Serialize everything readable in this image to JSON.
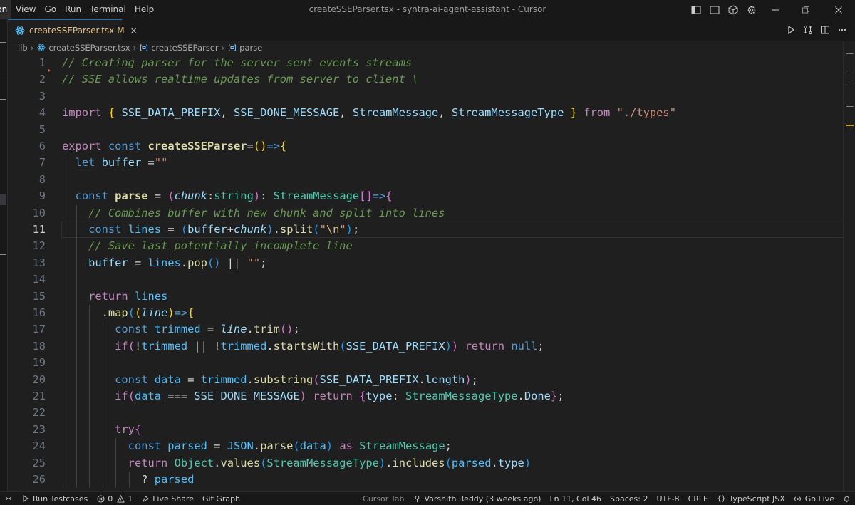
{
  "window": {
    "title": "createSSEParser.tsx - syntra-ai-agent-assistant - Cursor",
    "menu": [
      "ion",
      "View",
      "Go",
      "Run",
      "Terminal",
      "Help"
    ]
  },
  "tab": {
    "label": "createSSEParser.tsx",
    "modified": "M",
    "close": "×"
  },
  "breadcrumb": {
    "folder": "lib",
    "file": "createSSEParser.tsx",
    "symbol1": "createSSEParser",
    "symbol2": "parse"
  },
  "editor": {
    "active_line": 11,
    "lines": [
      {
        "n": "1",
        "tokens": [
          [
            "// Creating parser for the server sent events streams",
            "comment"
          ]
        ]
      },
      {
        "n": "2",
        "tokens": [
          [
            "// SSE allows realtime updates from server to client \\",
            "comment"
          ]
        ]
      },
      {
        "n": "3",
        "tokens": []
      },
      {
        "n": "4",
        "tokens": [
          [
            "import",
            "control"
          ],
          [
            " ",
            "punct"
          ],
          [
            "{",
            "b1"
          ],
          [
            " ",
            "punct"
          ],
          [
            "SSE_DATA_PREFIX",
            "var"
          ],
          [
            ", ",
            "punct"
          ],
          [
            "SSE_DONE_MESSAGE",
            "var"
          ],
          [
            ", ",
            "punct"
          ],
          [
            "StreamMessage",
            "var"
          ],
          [
            ", ",
            "punct"
          ],
          [
            "StreamMessageType",
            "var"
          ],
          [
            " ",
            "punct"
          ],
          [
            "}",
            "b1"
          ],
          [
            " ",
            "punct"
          ],
          [
            "from",
            "control"
          ],
          [
            " ",
            "punct"
          ],
          [
            "\"./types\"",
            "string"
          ]
        ]
      },
      {
        "n": "5",
        "tokens": []
      },
      {
        "n": "6",
        "tokens": [
          [
            "export",
            "control"
          ],
          [
            " ",
            "punct"
          ],
          [
            "const",
            "keyword"
          ],
          [
            " ",
            "punct"
          ],
          [
            "createSSEParser",
            "funcdecl"
          ],
          [
            "=",
            "punct"
          ],
          [
            "()",
            "b1"
          ],
          [
            "=>",
            "keyword"
          ],
          [
            "{",
            "b1"
          ]
        ]
      },
      {
        "n": "7",
        "tokens": [
          [
            "  ",
            "punct"
          ],
          [
            "let",
            "keyword"
          ],
          [
            " ",
            "punct"
          ],
          [
            "buffer",
            "var"
          ],
          [
            " =",
            "punct"
          ],
          [
            "\"\"",
            "string"
          ]
        ]
      },
      {
        "n": "8",
        "tokens": []
      },
      {
        "n": "9",
        "tokens": [
          [
            "  ",
            "punct"
          ],
          [
            "const",
            "keyword"
          ],
          [
            " ",
            "punct"
          ],
          [
            "parse",
            "funcdecl"
          ],
          [
            " = ",
            "punct"
          ],
          [
            "(",
            "b2"
          ],
          [
            "chunk",
            "param"
          ],
          [
            ":",
            "punct"
          ],
          [
            "string",
            "type"
          ],
          [
            ")",
            "b2"
          ],
          [
            ": ",
            "punct"
          ],
          [
            "StreamMessage",
            "type"
          ],
          [
            "[]",
            "b2"
          ],
          [
            "=>",
            "keyword"
          ],
          [
            "{",
            "b2"
          ]
        ]
      },
      {
        "n": "10",
        "tokens": [
          [
            "    ",
            "punct"
          ],
          [
            "// Combines buffer with new chunk and split into lines",
            "comment"
          ]
        ]
      },
      {
        "n": "11",
        "tokens": [
          [
            "    ",
            "punct"
          ],
          [
            "const",
            "keyword"
          ],
          [
            " ",
            "punct"
          ],
          [
            "lines",
            "const"
          ],
          [
            " = ",
            "punct"
          ],
          [
            "(",
            "b3"
          ],
          [
            "buffer",
            "var"
          ],
          [
            "+",
            "punct"
          ],
          [
            "chunk",
            "param"
          ],
          [
            ")",
            "b3"
          ],
          [
            ".",
            "punct"
          ],
          [
            "split",
            "func"
          ],
          [
            "(",
            "b3"
          ],
          [
            "\"",
            "string"
          ],
          [
            "\\n",
            "escape"
          ],
          [
            "\"",
            "string"
          ],
          [
            ")",
            "b3"
          ],
          [
            ";",
            "punct"
          ]
        ]
      },
      {
        "n": "12",
        "tokens": [
          [
            "    ",
            "punct"
          ],
          [
            "// Save last potentially incomplete line",
            "comment"
          ]
        ]
      },
      {
        "n": "13",
        "tokens": [
          [
            "    ",
            "punct"
          ],
          [
            "buffer",
            "var"
          ],
          [
            " = ",
            "punct"
          ],
          [
            "lines",
            "const"
          ],
          [
            ".",
            "punct"
          ],
          [
            "pop",
            "func"
          ],
          [
            "()",
            "b3"
          ],
          [
            " || ",
            "punct"
          ],
          [
            "\"\"",
            "string"
          ],
          [
            ";",
            "punct"
          ]
        ]
      },
      {
        "n": "14",
        "tokens": []
      },
      {
        "n": "15",
        "tokens": [
          [
            "    ",
            "punct"
          ],
          [
            "return",
            "control"
          ],
          [
            " ",
            "punct"
          ],
          [
            "lines",
            "const"
          ]
        ]
      },
      {
        "n": "16",
        "tokens": [
          [
            "      ",
            "punct"
          ],
          [
            ".",
            "punct"
          ],
          [
            "map",
            "func"
          ],
          [
            "(",
            "b3"
          ],
          [
            "(",
            "b1"
          ],
          [
            "line",
            "param"
          ],
          [
            ")",
            "b1"
          ],
          [
            "=>",
            "keyword"
          ],
          [
            "{",
            "b1"
          ]
        ]
      },
      {
        "n": "17",
        "tokens": [
          [
            "        ",
            "punct"
          ],
          [
            "const",
            "keyword"
          ],
          [
            " ",
            "punct"
          ],
          [
            "trimmed",
            "const"
          ],
          [
            " = ",
            "punct"
          ],
          [
            "line",
            "param"
          ],
          [
            ".",
            "punct"
          ],
          [
            "trim",
            "func"
          ],
          [
            "()",
            "b2"
          ],
          [
            ";",
            "punct"
          ]
        ]
      },
      {
        "n": "18",
        "tokens": [
          [
            "        ",
            "punct"
          ],
          [
            "if",
            "control"
          ],
          [
            "(",
            "b2"
          ],
          [
            "!",
            "punct"
          ],
          [
            "trimmed",
            "const"
          ],
          [
            " || ",
            "punct"
          ],
          [
            "!",
            "punct"
          ],
          [
            "trimmed",
            "const"
          ],
          [
            ".",
            "punct"
          ],
          [
            "startsWith",
            "func"
          ],
          [
            "(",
            "b3"
          ],
          [
            "SSE_DATA_PREFIX",
            "var"
          ],
          [
            ")",
            "b3"
          ],
          [
            ")",
            "b2"
          ],
          [
            " ",
            "punct"
          ],
          [
            "return",
            "control"
          ],
          [
            " ",
            "punct"
          ],
          [
            "null",
            "keyword"
          ],
          [
            ";",
            "punct"
          ]
        ]
      },
      {
        "n": "19",
        "tokens": []
      },
      {
        "n": "20",
        "tokens": [
          [
            "        ",
            "punct"
          ],
          [
            "const",
            "keyword"
          ],
          [
            " ",
            "punct"
          ],
          [
            "data",
            "const"
          ],
          [
            " = ",
            "punct"
          ],
          [
            "trimmed",
            "const"
          ],
          [
            ".",
            "punct"
          ],
          [
            "substring",
            "func"
          ],
          [
            "(",
            "b2"
          ],
          [
            "SSE_DATA_PREFIX",
            "var"
          ],
          [
            ".",
            "punct"
          ],
          [
            "length",
            "var"
          ],
          [
            ")",
            "b2"
          ],
          [
            ";",
            "punct"
          ]
        ]
      },
      {
        "n": "21",
        "tokens": [
          [
            "        ",
            "punct"
          ],
          [
            "if",
            "control"
          ],
          [
            "(",
            "b2"
          ],
          [
            "data",
            "const"
          ],
          [
            " === ",
            "punct"
          ],
          [
            "SSE_DONE_MESSAGE",
            "var"
          ],
          [
            ")",
            "b2"
          ],
          [
            " ",
            "punct"
          ],
          [
            "return",
            "control"
          ],
          [
            " ",
            "punct"
          ],
          [
            "{",
            "b2"
          ],
          [
            "type",
            "var"
          ],
          [
            ": ",
            "punct"
          ],
          [
            "StreamMessageType",
            "type"
          ],
          [
            ".",
            "punct"
          ],
          [
            "Done",
            "var"
          ],
          [
            "}",
            "b2"
          ],
          [
            ";",
            "punct"
          ]
        ]
      },
      {
        "n": "22",
        "tokens": []
      },
      {
        "n": "23",
        "tokens": [
          [
            "        ",
            "punct"
          ],
          [
            "try",
            "control"
          ],
          [
            "{",
            "b2"
          ]
        ]
      },
      {
        "n": "24",
        "tokens": [
          [
            "          ",
            "punct"
          ],
          [
            "const",
            "keyword"
          ],
          [
            " ",
            "punct"
          ],
          [
            "parsed",
            "const"
          ],
          [
            " = ",
            "punct"
          ],
          [
            "JSON",
            "const"
          ],
          [
            ".",
            "punct"
          ],
          [
            "parse",
            "func"
          ],
          [
            "(",
            "b3"
          ],
          [
            "data",
            "const"
          ],
          [
            ")",
            "b3"
          ],
          [
            " ",
            "punct"
          ],
          [
            "as",
            "control"
          ],
          [
            " ",
            "punct"
          ],
          [
            "StreamMessage",
            "type"
          ],
          [
            ";",
            "punct"
          ]
        ]
      },
      {
        "n": "25",
        "tokens": [
          [
            "          ",
            "punct"
          ],
          [
            "return",
            "control"
          ],
          [
            " ",
            "punct"
          ],
          [
            "Object",
            "type"
          ],
          [
            ".",
            "punct"
          ],
          [
            "values",
            "func"
          ],
          [
            "(",
            "b3"
          ],
          [
            "StreamMessageType",
            "type"
          ],
          [
            ")",
            "b3"
          ],
          [
            ".",
            "punct"
          ],
          [
            "includes",
            "func"
          ],
          [
            "(",
            "b3"
          ],
          [
            "parsed",
            "const"
          ],
          [
            ".",
            "punct"
          ],
          [
            "type",
            "var"
          ],
          [
            ")",
            "b3"
          ]
        ]
      },
      {
        "n": "26",
        "tokens": [
          [
            "            ",
            "punct"
          ],
          [
            "? ",
            "punct"
          ],
          [
            "parsed",
            "const"
          ]
        ]
      }
    ]
  },
  "statusbar": {
    "run_testcases": "Run Testcases",
    "errors": "0",
    "warnings": "1",
    "live_share": "Live Share",
    "git_graph": "Git Graph",
    "cursor_tab": "Cursor Tab",
    "blame": "Varshith Reddy (3 weeks ago)",
    "position": "Ln 11, Col 46",
    "spaces": "Spaces: 2",
    "encoding": "UTF-8",
    "eol": "CRLF",
    "language": "TypeScript JSX",
    "go_live": "Go Live"
  },
  "colors": {
    "accent": "#0078d4",
    "modified": "#e2c08d",
    "react_icon": "#4fc1ff"
  },
  "icons": [
    "toggle-primary-sidebar-icon",
    "toggle-panel-icon",
    "toggle-secondary-sidebar-icon",
    "layout-icon",
    "settings-gear-icon",
    "minimize-icon",
    "restore-icon",
    "close-window-icon",
    "run-icon",
    "compare-changes-icon",
    "split-editor-icon",
    "more-actions-icon"
  ]
}
